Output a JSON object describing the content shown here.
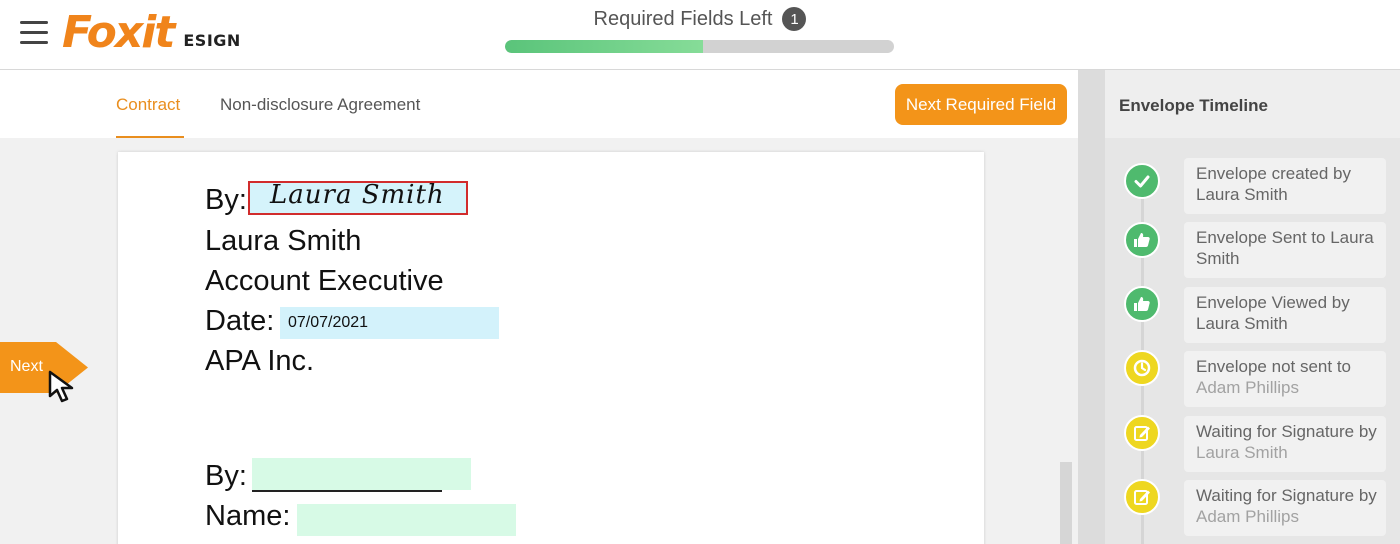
{
  "header": {
    "logo_text": "Foxit",
    "logo_sub": "ESIGN",
    "required_label": "Required Fields Left",
    "required_count": "1",
    "progress_fraction": 0.51
  },
  "tabs": [
    {
      "label": "Contract",
      "active": true
    },
    {
      "label": "Non-disclosure Agreement",
      "active": false
    }
  ],
  "toolbar": {
    "next_required_label": "Next Required Field"
  },
  "document": {
    "by_label": "By:",
    "signature_text": "Laura Smith",
    "signer_name": "Laura Smith",
    "signer_title": "Account Executive",
    "date_label": "Date:",
    "date_value": "07/07/2021",
    "company": "APA Inc.",
    "by_label_2": "By:",
    "name_label": "Name:"
  },
  "next_tag": {
    "label": "Next"
  },
  "sidebar": {
    "title": "Envelope Timeline",
    "events": [
      {
        "icon": "check-icon",
        "color": "#4fba6e",
        "line1": "Envelope created by",
        "line2": "Laura Smith",
        "line2_muted": false
      },
      {
        "icon": "thumbs-up-icon",
        "color": "#4fba6e",
        "line1": "Envelope Sent to Laura",
        "line2": "Smith",
        "line2_muted": false
      },
      {
        "icon": "thumbs-up-icon",
        "color": "#4fba6e",
        "line1": "Envelope Viewed by",
        "line2": "Laura Smith",
        "line2_muted": false
      },
      {
        "icon": "clock-icon",
        "color": "#eed720",
        "line1": "Envelope not sent to",
        "line2": "Adam Phillips",
        "line2_muted": true
      },
      {
        "icon": "edit-icon",
        "color": "#eed720",
        "line1": "Waiting for Signature by",
        "line2": "Laura Smith",
        "line2_muted": true
      },
      {
        "icon": "edit-icon",
        "color": "#eed720",
        "line1": "Waiting for Signature by",
        "line2": "Adam Phillips",
        "line2_muted": true
      }
    ]
  }
}
